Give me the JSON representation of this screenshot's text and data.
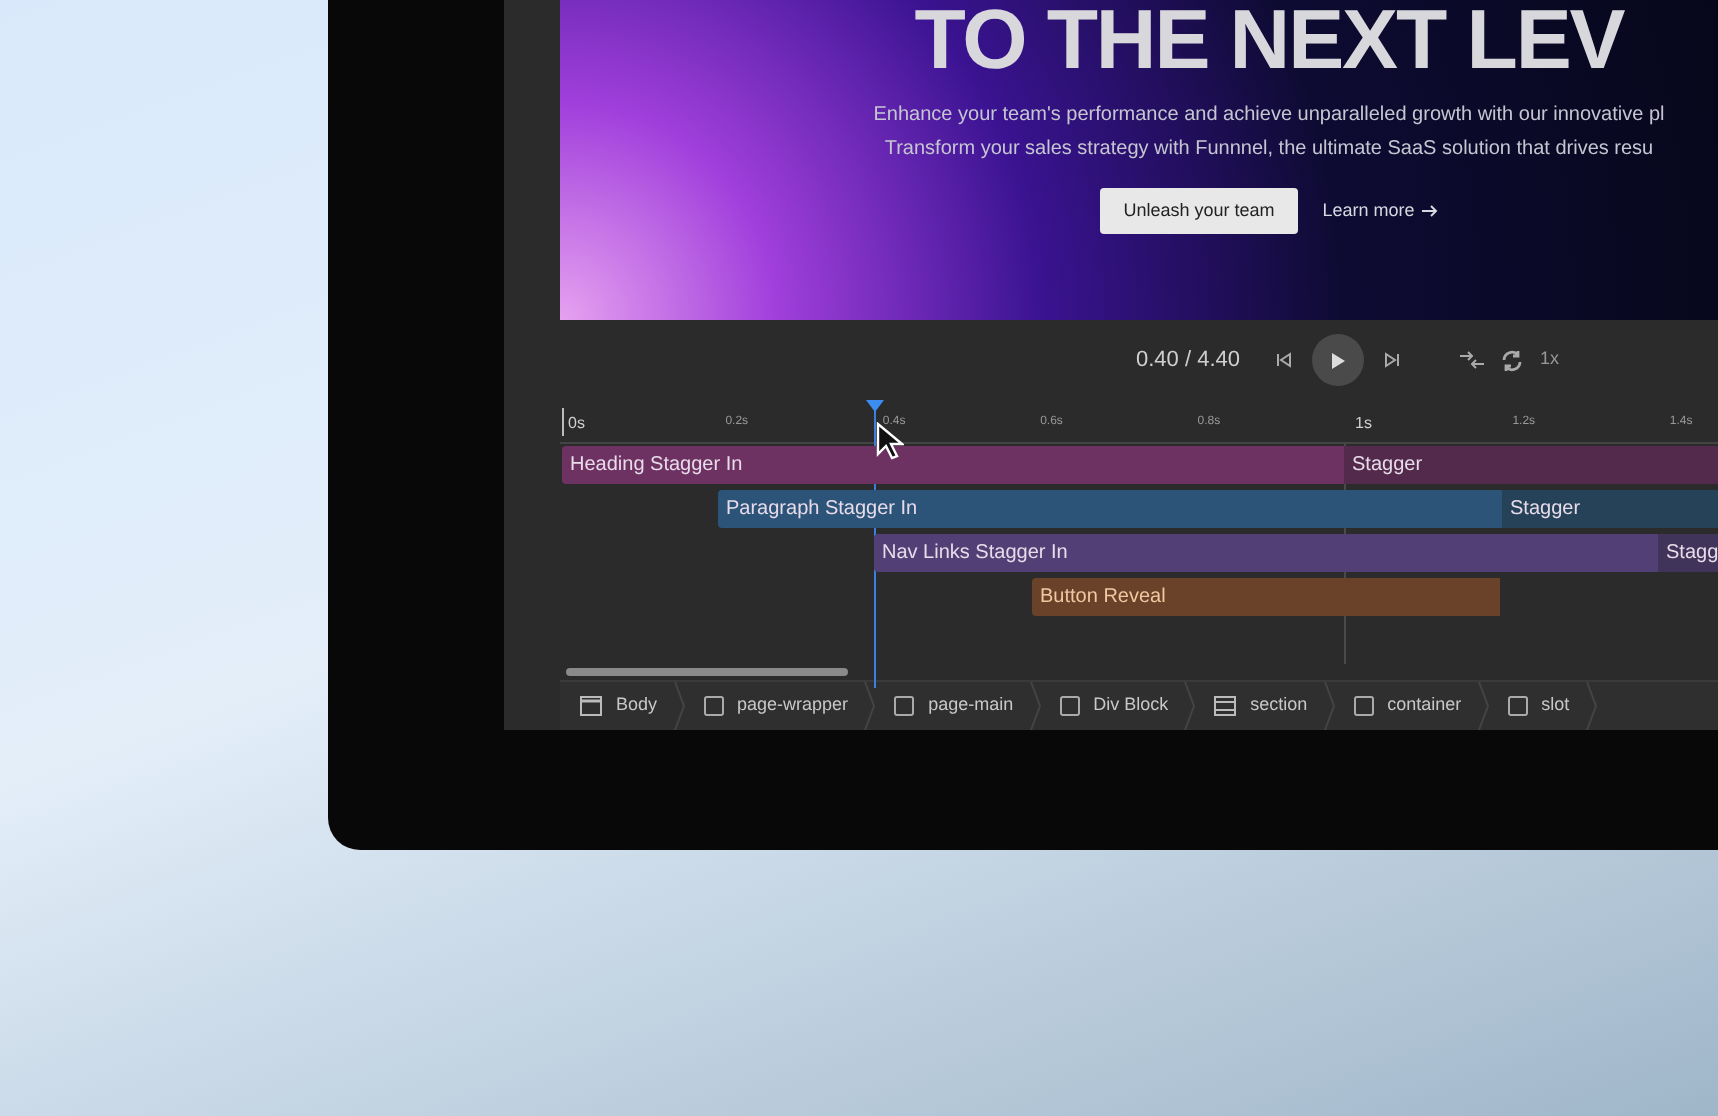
{
  "preview": {
    "heading": "TO THE NEXT LEV",
    "lines": [
      "Enhance your team's performance and achieve unparalleled growth with our innovative pl",
      "Transform your sales strategy with Funnnel, the ultimate SaaS solution that drives resu"
    ],
    "primary_button": "Unleash your team",
    "link": "Learn more"
  },
  "controls": {
    "time": "0.40 / 4.40",
    "speed": "1x"
  },
  "ruler": [
    "0s",
    "0.2s",
    "0.4s",
    "0.6s",
    "0.8s",
    "1s",
    "1.2s",
    "1.4s"
  ],
  "tracks": [
    {
      "segments": [
        {
          "label": "Heading Stagger In",
          "color": "#6e3262"
        },
        {
          "label": "Stagger",
          "color": "#532a4b"
        }
      ]
    },
    {
      "segments": [
        {
          "label": "Paragraph Stagger In",
          "color": "#2c5378"
        },
        {
          "label": "Stagger",
          "color": "#264259"
        }
      ]
    },
    {
      "segments": [
        {
          "label": "Nav Links Stagger In",
          "color": "#523f76"
        },
        {
          "label": "Stagg",
          "color": "#40345a"
        }
      ]
    },
    {
      "segments": [
        {
          "label": "Button Reveal",
          "color": "#6a4129"
        }
      ]
    }
  ],
  "breadcrumb": [
    {
      "label": "Body",
      "kind": "body"
    },
    {
      "label": "page-wrapper",
      "kind": "box"
    },
    {
      "label": "page-main",
      "kind": "box"
    },
    {
      "label": "Div Block",
      "kind": "box"
    },
    {
      "label": "section",
      "kind": "section"
    },
    {
      "label": "container",
      "kind": "box"
    },
    {
      "label": "slot",
      "kind": "box"
    }
  ]
}
